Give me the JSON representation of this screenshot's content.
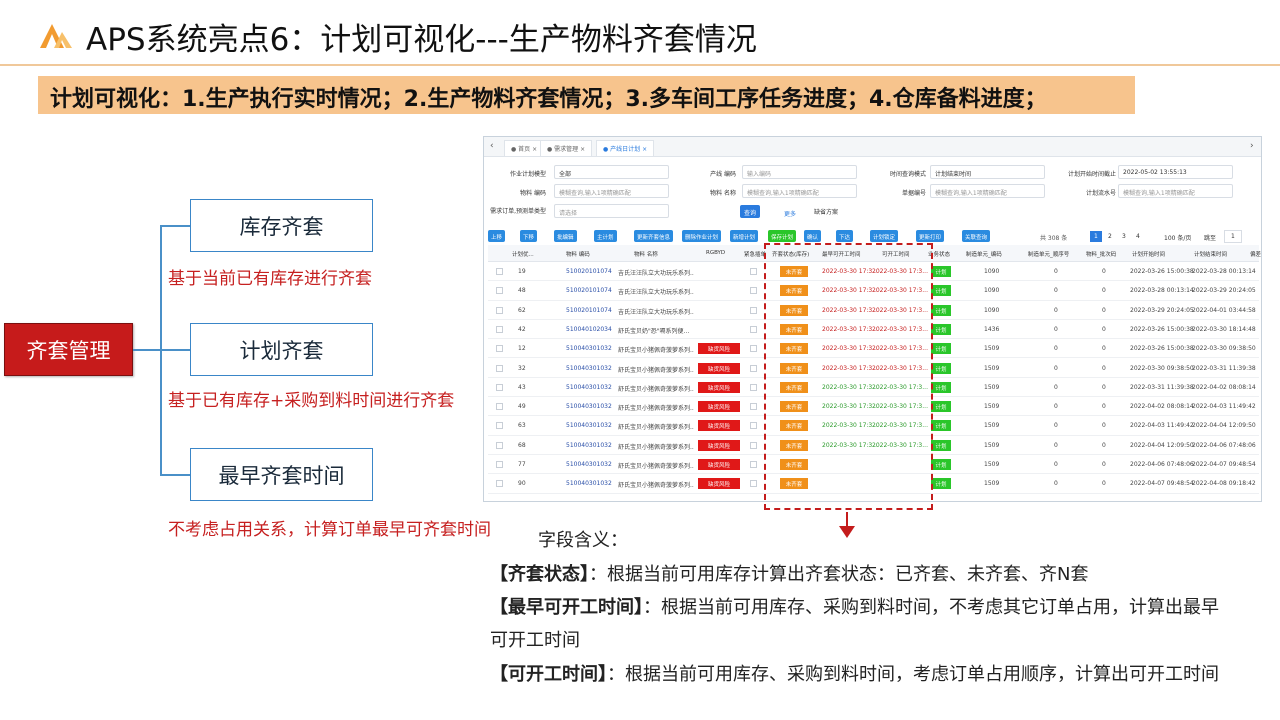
{
  "title": "APS系统亮点6：计划可视化---生产物料齐套情况",
  "banner": "计划可视化：1.生产执行实时情况；2.生产物料齐套情况；3.多车间工序任务进度；4.仓库备料进度；",
  "diagram": {
    "root": "齐套管理",
    "branches": [
      {
        "label": "库存齐套",
        "note": "基于当前已有库存进行齐套"
      },
      {
        "label": "计划齐套",
        "note": "基于已有库存+采购到料时间进行齐套"
      },
      {
        "label": "最早齐套时间",
        "note": "不考虑占用关系，计算订单最早可齐套时间"
      }
    ]
  },
  "screenshot": {
    "tabs": [
      "首页",
      "需求管理",
      "产线日计划"
    ],
    "filters": {
      "plan_type_label": "作业计划模型",
      "plan_type_value": "全部",
      "line_code_label": "产线 编码",
      "line_code_placeholder": "输入编码",
      "time_mode_label": "时间查询模式",
      "time_mode_value": "计划结束时间",
      "plan_start_label": "计划开始时间截止",
      "plan_start_value": "2022-05-02 13:55:13",
      "material_code_label": "物料 编码",
      "material_code_placeholder": "模糊查询,输入1项精确匹配",
      "material_name_label": "物料 名称",
      "material_name_placeholder": "模糊查询,输入1项精确匹配",
      "doc_no_label": "单据编号",
      "doc_no_placeholder": "模糊查询,输入1项精确匹配",
      "plan_seq_label": "计划流水号",
      "plan_seq_placeholder": "模糊查询,输入1项精确匹配",
      "demand_label": "需求订单,预测单类型",
      "demand_placeholder": "请选择",
      "query_btn": "查询",
      "more": "更多",
      "default_scheme": "缺省方案"
    },
    "toolbar": [
      "上移",
      "下移",
      "批编辑",
      "主计划",
      "更新齐套信息",
      "删除作业计划",
      "新增计划",
      "保存计划",
      "确认",
      "下达",
      "计划锁定",
      "更新打印",
      "关联查询"
    ],
    "pagination": {
      "total": "共 308 条",
      "pages": [
        "1",
        "2",
        "3",
        "4"
      ],
      "page_size": "100 条/页",
      "jump": "跳至",
      "jump_value": "1"
    },
    "columns": [
      "计划优...",
      "物料 编码",
      "物料 名称",
      "RGBYD",
      "紧急插单",
      "齐套状态(库存)",
      "最早可开工时间",
      "可开工时间",
      "业务状态",
      "制造单元_编码",
      "制造单元_顺序号",
      "物料_批次码",
      "计划开始时间",
      "计划结束时间",
      "偏差"
    ],
    "rows": [
      {
        "seq": "19",
        "code": "510020101074",
        "name": "吉氏汪汪队立大功玩乐系列...",
        "risk": "",
        "kit": "未齐套",
        "earliest": "2022-03-30 17:3...",
        "start": "2022-03-30 17:3...",
        "status": "计划",
        "unit": "1090",
        "order": "0",
        "batch": "0",
        "plan_start": "2022-03-26 15:00:38",
        "plan_end": "2022-03-28 00:13:14"
      },
      {
        "seq": "48",
        "code": "510020101074",
        "name": "吉氏汪汪队立大功玩乐系列...",
        "risk": "",
        "kit": "未齐套",
        "earliest": "2022-03-30 17:3...",
        "start": "2022-03-30 17:3...",
        "status": "计划",
        "unit": "1090",
        "order": "0",
        "batch": "0",
        "plan_start": "2022-03-28 00:13:14",
        "plan_end": "2022-03-29 20:24:05"
      },
      {
        "seq": "62",
        "code": "510020101074",
        "name": "吉氏汪汪队立大功玩乐系列...",
        "risk": "",
        "kit": "未齐套",
        "earliest": "2022-03-30 17:3...",
        "start": "2022-03-30 17:3...",
        "status": "计划",
        "unit": "1090",
        "order": "0",
        "batch": "0",
        "plan_start": "2022-03-29 20:24:05",
        "plan_end": "2022-04-01 03:44:58"
      },
      {
        "seq": "42",
        "code": "510040102034",
        "name": "舒氏宝贝奶\"恐\"嗝系列便...",
        "risk": "",
        "kit": "未齐套",
        "earliest": "2022-03-30 17:3...",
        "start": "2022-03-30 17:3...",
        "status": "计划",
        "unit": "1436",
        "order": "0",
        "batch": "0",
        "plan_start": "2022-03-26 15:00:38",
        "plan_end": "2022-03-30 18:14:48"
      },
      {
        "seq": "12",
        "code": "510040301032",
        "name": "舒氏宝贝小猪佩奇菠萝系列...",
        "risk": "缺货风险",
        "kit": "未齐套",
        "earliest": "2022-03-30 17:3...",
        "start": "2022-03-30 17:3...",
        "status": "计划",
        "unit": "1509",
        "order": "0",
        "batch": "0",
        "plan_start": "2022-03-26 15:00:38",
        "plan_end": "2022-03-30 09:38:50"
      },
      {
        "seq": "32",
        "code": "510040301032",
        "name": "舒氏宝贝小猪佩奇菠萝系列...",
        "risk": "缺货风险",
        "kit": "未齐套",
        "earliest": "2022-03-30 17:3...",
        "start": "2022-03-30 17:3...",
        "status": "计划",
        "unit": "1509",
        "order": "0",
        "batch": "0",
        "plan_start": "2022-03-30 09:38:50",
        "plan_end": "2022-03-31 11:39:38"
      },
      {
        "seq": "43",
        "code": "510040301032",
        "name": "舒氏宝贝小猪佩奇菠萝系列...",
        "risk": "缺货风险",
        "kit": "未齐套",
        "earliest": "2022-03-30 17:3...",
        "start": "2022-03-30 17:3...",
        "status": "计划",
        "unit": "1509",
        "order": "0",
        "batch": "0",
        "plan_start": "2022-03-31 11:39:38",
        "plan_end": "2022-04-02 08:08:14"
      },
      {
        "seq": "49",
        "code": "510040301032",
        "name": "舒氏宝贝小猪佩奇菠萝系列...",
        "risk": "缺货风险",
        "kit": "未齐套",
        "earliest": "2022-03-30 17:3...",
        "start": "2022-03-30 17:3...",
        "status": "计划",
        "unit": "1509",
        "order": "0",
        "batch": "0",
        "plan_start": "2022-04-02 08:08:14",
        "plan_end": "2022-04-03 11:49:42"
      },
      {
        "seq": "63",
        "code": "510040301032",
        "name": "舒氏宝贝小猪佩奇菠萝系列...",
        "risk": "缺货风险",
        "kit": "未齐套",
        "earliest": "2022-03-30 17:3...",
        "start": "2022-03-30 17:3...",
        "status": "计划",
        "unit": "1509",
        "order": "0",
        "batch": "0",
        "plan_start": "2022-04-03 11:49:42",
        "plan_end": "2022-04-04 12:09:50"
      },
      {
        "seq": "68",
        "code": "510040301032",
        "name": "舒氏宝贝小猪佩奇菠萝系列...",
        "risk": "缺货风险",
        "kit": "未齐套",
        "earliest": "2022-03-30 17:3...",
        "start": "2022-03-30 17:3...",
        "status": "计划",
        "unit": "1509",
        "order": "0",
        "batch": "0",
        "plan_start": "2022-04-04 12:09:50",
        "plan_end": "2022-04-06 07:48:06"
      },
      {
        "seq": "77",
        "code": "510040301032",
        "name": "舒氏宝贝小猪佩奇菠萝系列...",
        "risk": "缺货风险",
        "kit": "未齐套",
        "earliest": "",
        "start": "",
        "status": "计划",
        "unit": "1509",
        "order": "0",
        "batch": "0",
        "plan_start": "2022-04-06 07:48:06",
        "plan_end": "2022-04-07 09:48:54"
      },
      {
        "seq": "90",
        "code": "510040301032",
        "name": "舒氏宝贝小猪佩奇菠萝系列...",
        "risk": "缺货风险",
        "kit": "未齐套",
        "earliest": "",
        "start": "",
        "status": "计划",
        "unit": "1509",
        "order": "0",
        "batch": "0",
        "plan_start": "2022-04-07 09:48:54",
        "plan_end": "2022-04-08 09:18:42"
      }
    ]
  },
  "explanation": {
    "heading": "字段含义：",
    "lines": [
      {
        "key": "【齐套状态】",
        "text": "：根据当前可用库存计算出齐套状态：已齐套、未齐套、齐N套"
      },
      {
        "key": "【最早可开工时间】",
        "text": "：根据当前可用库存、采购到料时间，不考虑其它订单占用，计算出最早"
      },
      {
        "key": "",
        "text": "可开工时间"
      },
      {
        "key": "【可开工时间】",
        "text": "：根据当前可用库存、采购到料时间，考虑订单占用顺序，计算出可开工时间"
      }
    ]
  },
  "colors": {
    "accent": "#c61b1b",
    "banner": "#f7c48d",
    "box_border": "#3a86c8",
    "risk": "#e01818",
    "kit": "#f0901a",
    "status": "#2ac62a"
  }
}
